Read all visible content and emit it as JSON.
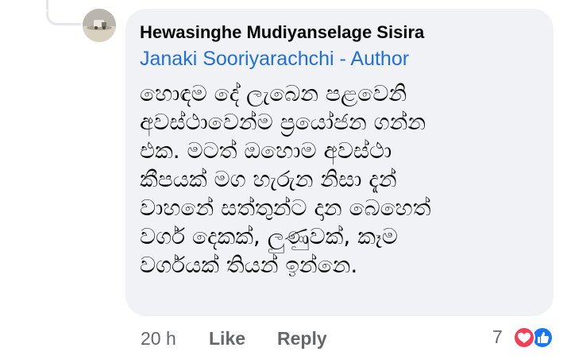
{
  "comment": {
    "author": "Hewasinghe Mudiyanselage Sisira",
    "mention": "Janaki Sooriyarachchi - Author",
    "text_lines": [
      "හොඳම දේ ලැබෙන පළවෙනි",
      "අවස්ථාවෙන්ම ප්‍රයෝජන ගන්න",
      "එක. මටත් ඔහොම අවස්ථා",
      "කීපයක් මග හැරුන නිසා දැන්",
      "වාහනේ සත්තුන්ට දාන බෙහෙත්",
      "වර්ග දෙකක්, ලුණුවක්, කෑම",
      "වර්ගයක් තියන් ඉන්නෙ."
    ]
  },
  "actions": {
    "time": "20 h",
    "like_label": "Like",
    "reply_label": "Reply"
  },
  "reactions": {
    "count": "7",
    "icons": [
      "love-icon",
      "like-icon"
    ],
    "love_color": "#f33e58",
    "like_color": "#1877f2"
  },
  "colors": {
    "bubble_bg": "#f0f2f5",
    "mention_link": "#216fdb",
    "secondary_text": "#65676b"
  }
}
